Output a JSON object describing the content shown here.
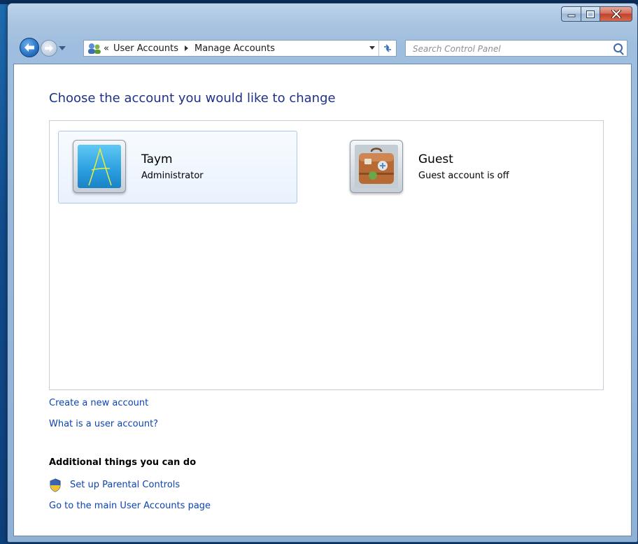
{
  "window": {
    "controls": {
      "minimize": "minimize",
      "maximize": "maximize",
      "close": "close"
    }
  },
  "navigation": {
    "address": {
      "overflow": "«",
      "breadcrumbs": [
        "User Accounts",
        "Manage Accounts"
      ]
    },
    "search": {
      "placeholder": "Search Control Panel"
    }
  },
  "main": {
    "heading": "Choose the account you would like to change",
    "accounts": [
      {
        "name": "Taym",
        "role": "Administrator",
        "avatar": "letter-a-drawing",
        "selected": true
      },
      {
        "name": "Guest",
        "role": "Guest account is off",
        "avatar": "suitcase",
        "selected": false
      }
    ],
    "links": {
      "create": "Create a new account",
      "what_is": "What is a user account?"
    },
    "additional": {
      "title": "Additional things you can do",
      "parental": "Set up Parental Controls",
      "main_page": "Go to the main User Accounts page"
    }
  },
  "colors": {
    "link": "#0d43b3",
    "heading": "#1e3287",
    "selection_border": "#aac9f0",
    "close_button": "#c1422a"
  }
}
